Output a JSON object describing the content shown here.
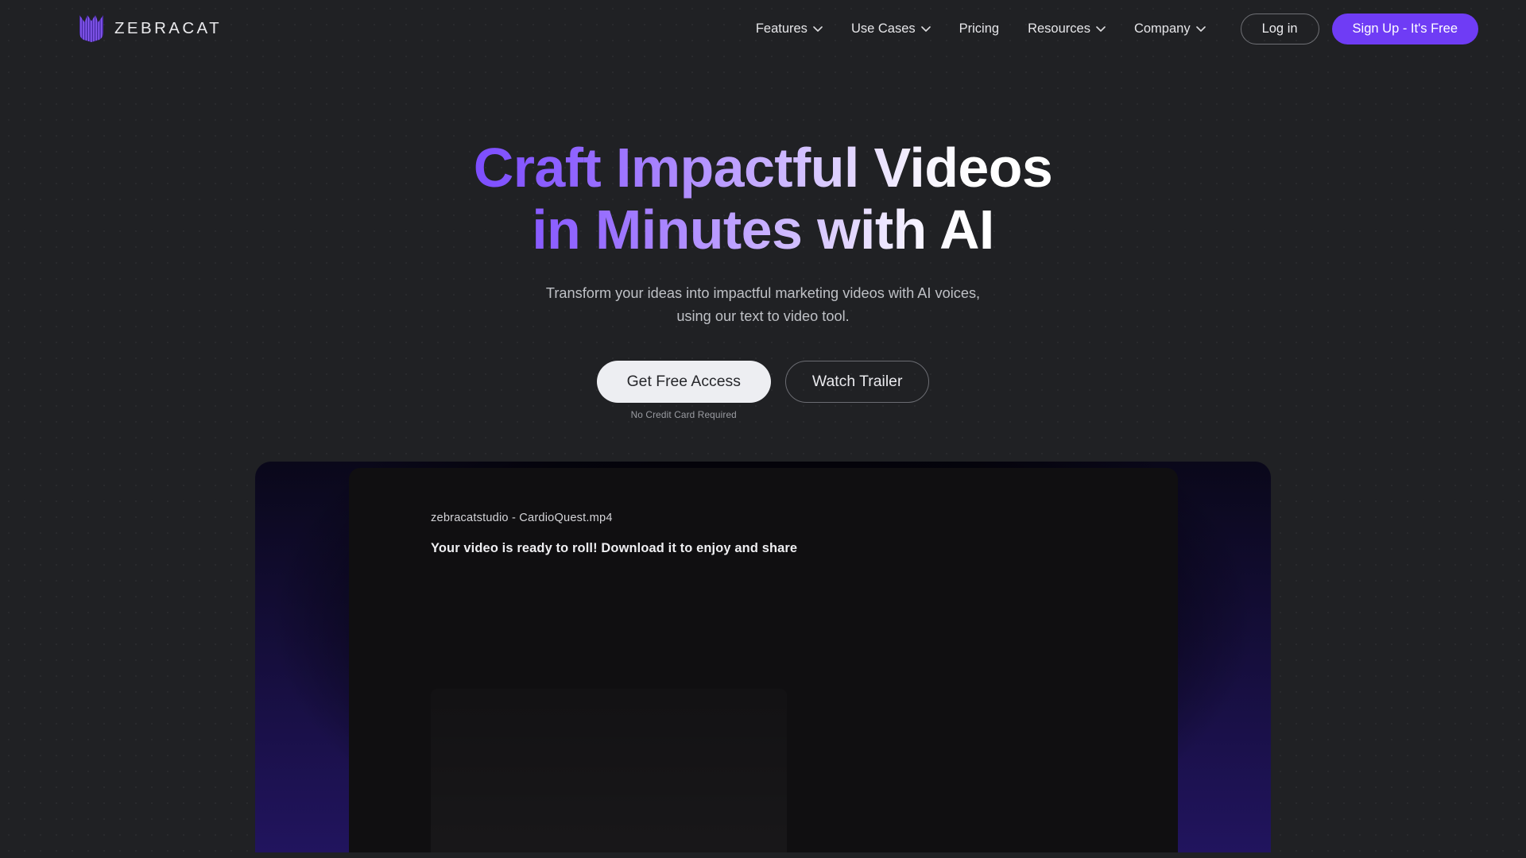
{
  "brand": {
    "name": "ZEBRACAT",
    "logo_icon": "zebracat-cat-mark-icon",
    "accent": "#6F3CF5"
  },
  "nav": {
    "items": [
      {
        "label": "Features",
        "has_dropdown": true,
        "icon": "chevron-down-icon"
      },
      {
        "label": "Use Cases",
        "has_dropdown": true,
        "icon": "chevron-down-icon"
      },
      {
        "label": "Pricing",
        "has_dropdown": false,
        "icon": ""
      },
      {
        "label": "Resources",
        "has_dropdown": true,
        "icon": "chevron-down-icon"
      },
      {
        "label": "Company",
        "has_dropdown": true,
        "icon": "chevron-down-icon"
      }
    ],
    "login_label": "Log in",
    "signup_label": "Sign Up - It's Free"
  },
  "hero": {
    "headline_line1": "Craft Impactful Videos",
    "headline_line2": "in Minutes with AI",
    "headline_gradient_from": "#7C4DFF",
    "headline_gradient_to": "#FFFFFF",
    "subhead_line1": "Transform your ideas into impactful marketing videos with AI voices,",
    "subhead_line2": "using our text to video tool.",
    "primary_cta": "Get Free Access",
    "primary_cta_note": "No Credit Card Required",
    "secondary_cta": "Watch Trailer"
  },
  "showcase": {
    "video_meta": "zebracatstudio - CardioQuest.mp4",
    "video_status": "Your video is ready to roll! Download it to enjoy and share",
    "glow_color": "#21145E",
    "card_background": "#100F11"
  },
  "theme": {
    "page_background": "#202124",
    "text_primary": "#EDEDF0",
    "text_muted": "#BFC1C6"
  }
}
